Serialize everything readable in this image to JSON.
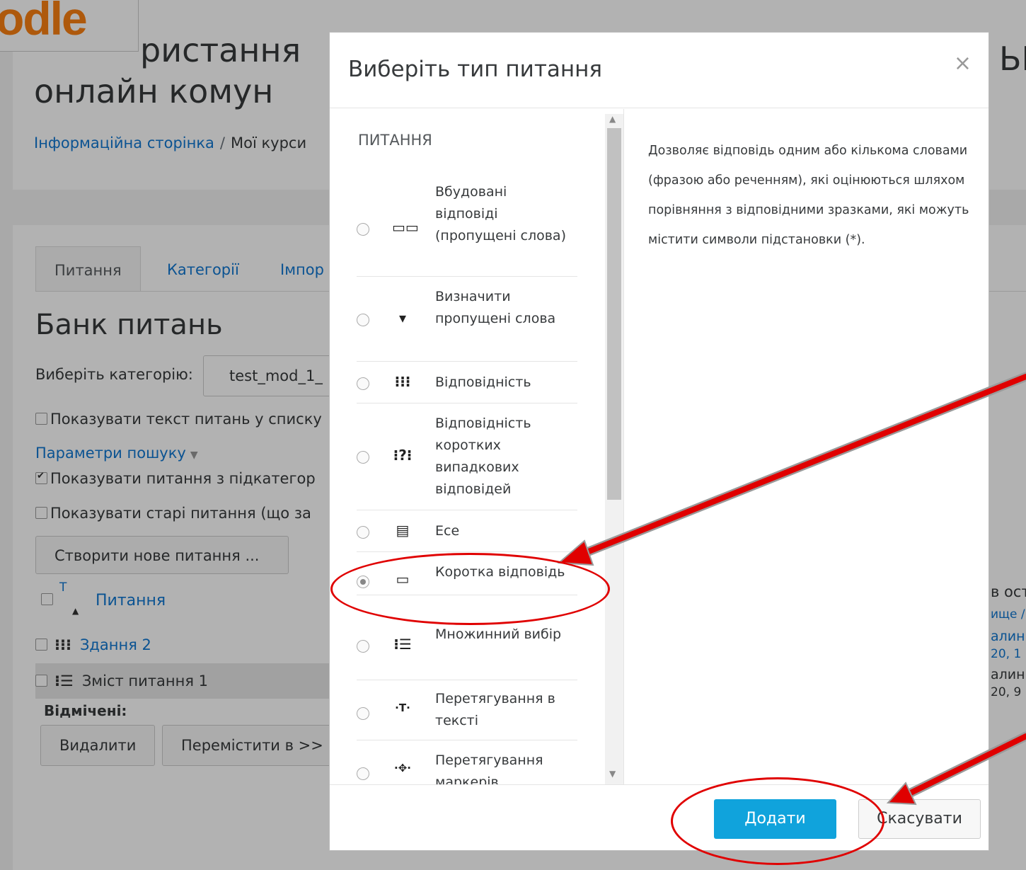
{
  "logo": {
    "text": "odle"
  },
  "page": {
    "heading_line1": "ристання",
    "heading_line2": "онлайн комун",
    "breadcrumb": {
      "home": "Інформаційна сторінка",
      "separator": "/",
      "current": "Мої курси"
    }
  },
  "tabs": [
    {
      "label": "Питання"
    },
    {
      "label": "Категорії"
    },
    {
      "label": "Імпор"
    }
  ],
  "bank": {
    "title": "Банк питань",
    "category_label": "Виберіть категорію:",
    "category_value": "test_mod_1_",
    "show_text": "Показувати текст питань у списку",
    "search_params": "Параметри пошуку",
    "show_subcat": "Показувати питання з підкатегор",
    "show_old": "Показувати старі питання (що за",
    "create_button": "Створити нове питання ...",
    "sort_marker": "T",
    "column_question": "Питання",
    "rows": [
      {
        "icon": "⁝⁝⁝",
        "label": "Здання 2"
      },
      {
        "icon": "⁝☰",
        "label": "Зміст питання 1"
      }
    ],
    "selected_label": "Відмічені:",
    "delete_button": "Видалити",
    "move_button": "Перемістити в >>"
  },
  "right_fragments": [
    "ЬН",
    "в ост",
    "ище /",
    "алин",
    "20, 1",
    "алин",
    "20, 9"
  ],
  "modal": {
    "title": "Виберіть тип питання",
    "close": "×",
    "category": "ПИТАННЯ",
    "options": [
      {
        "label": "Вбудовані відповіді (пропущені слова)",
        "icon": "▭▭",
        "selected": false
      },
      {
        "label": "Визначити пропущені слова",
        "icon": "▾",
        "selected": false
      },
      {
        "label": "Відповідність",
        "icon": "⁝⁝⁝",
        "selected": false
      },
      {
        "label": "Відповідність коротких випадкових відповідей",
        "icon": "⁝?⁝",
        "selected": false
      },
      {
        "label": "Есе",
        "icon": "▤",
        "selected": false
      },
      {
        "label": "Коротка відповідь",
        "icon": "▭",
        "selected": true
      },
      {
        "label": "Множинний вибір",
        "icon": "⁝☰",
        "selected": false
      },
      {
        "label": "Перетягування в тексті",
        "icon": "·T·",
        "selected": false
      },
      {
        "label": "Перетягування маркерів",
        "icon": "·✥·",
        "selected": false
      }
    ],
    "description": "Дозволяє відповідь одним або кількома словами (фразою або реченням), які оцінюються шляхом порівняння з відповідними зразками, які можуть містити символи підстановки (*).",
    "add_button": "Додати",
    "cancel_button": "Скасувати"
  },
  "colors": {
    "accent": "#10a3dc",
    "link": "#1177d1",
    "annotation": "#e00000",
    "brand": "#f98012"
  }
}
